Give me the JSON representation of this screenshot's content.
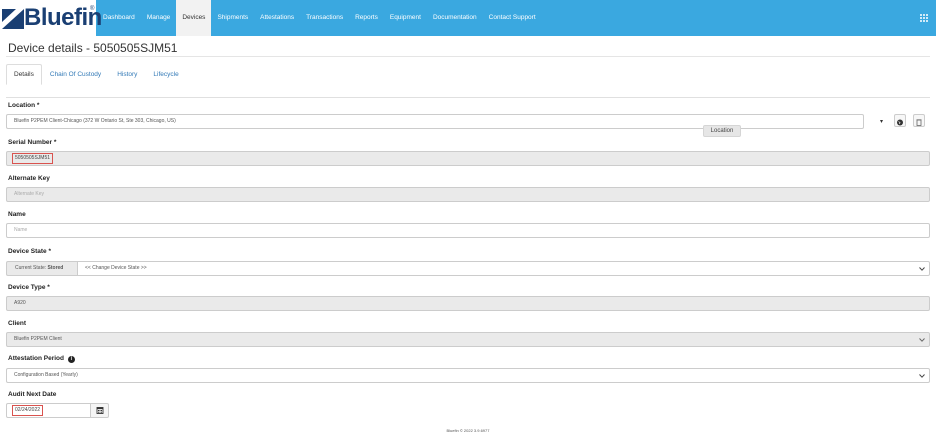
{
  "header": {
    "brand": "Bluefin",
    "brand_reg": "®",
    "nav": [
      "Dashboard",
      "Manage",
      "Devices",
      "Shipments",
      "Attestations",
      "Transactions",
      "Reports",
      "Equipment",
      "Documentation",
      "Contact Support"
    ],
    "active_nav": "Devices",
    "brand_color": "#1a3f73",
    "nav_color": "#3aa8e0"
  },
  "page": {
    "title": "Device details - 5050505SJM51"
  },
  "tabs": [
    "Details",
    "Chain Of Custody",
    "History",
    "Lifecycle"
  ],
  "form": {
    "location": {
      "label": "Location *",
      "value": "Bluefin P2PEM Client-Chicago (372 W Ontario St, Ste 303, Chicago, US)",
      "tooltip": "Location"
    },
    "serial_number": {
      "label": "Serial Number *",
      "value": "5050505SJM51"
    },
    "alternate_key": {
      "label": "Alternate Key",
      "placeholder": "Alternate Key"
    },
    "name": {
      "label": "Name",
      "placeholder": "Name"
    },
    "device_state": {
      "label": "Device State *",
      "current_prefix": "Current State:",
      "current_value": "Stored",
      "change_option": "<< Change Device State >>"
    },
    "device_type": {
      "label": "Device Type *",
      "value": "A920"
    },
    "client": {
      "label": "Client",
      "value": "Bluefin P2PEM Client"
    },
    "attestation_period": {
      "label": "Attestation Period",
      "value": "Configuration Based (Yearly)"
    },
    "audit_next_date": {
      "label": "Audit Next Date",
      "value": "02/24/2022"
    }
  },
  "footer": "Bluefin © 2022 3.9.6977"
}
